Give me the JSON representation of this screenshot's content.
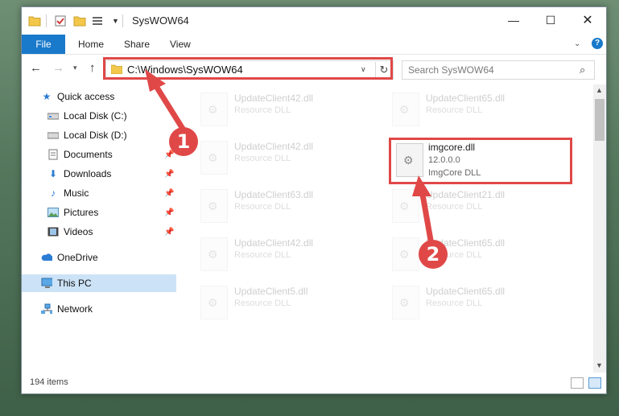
{
  "titlebar": {
    "title": "SysWOW64",
    "minimize": "—",
    "maximize": "☐",
    "close": "✕"
  },
  "ribbon": {
    "tabs": [
      "File",
      "Home",
      "Share",
      "View"
    ],
    "help": "?"
  },
  "navigation": {
    "address_path": "C:\\Windows\\SysWOW64",
    "search_placeholder": "Search SysWOW64"
  },
  "sidebar": {
    "items": [
      {
        "label": "Quick access",
        "icon": "star-icon"
      },
      {
        "label": "Local Disk (C:)",
        "icon": "drive-icon"
      },
      {
        "label": "Local Disk (D:)",
        "icon": "drive-icon"
      },
      {
        "label": "Documents",
        "icon": "documents-icon",
        "pinned": true
      },
      {
        "label": "Downloads",
        "icon": "downloads-icon",
        "pinned": true
      },
      {
        "label": "Music",
        "icon": "music-icon",
        "pinned": true
      },
      {
        "label": "Pictures",
        "icon": "pictures-icon",
        "pinned": true
      },
      {
        "label": "Videos",
        "icon": "videos-icon",
        "pinned": true
      },
      {
        "label": "OneDrive",
        "icon": "cloud-icon"
      },
      {
        "label": "This PC",
        "icon": "computer-icon",
        "selected": true
      },
      {
        "label": "Network",
        "icon": "network-icon"
      }
    ]
  },
  "files": [
    {
      "name": "UpdateClient42.dll",
      "desc": "Resource DLL"
    },
    {
      "name": "UpdateClient65.dll",
      "desc": "Resource DLL"
    },
    {
      "name": "UpdateClient42.dll",
      "desc": "Resource DLL"
    },
    {
      "name": "imgcore.dll",
      "version": "12.0.0.0",
      "desc": "ImgCore DLL"
    },
    {
      "name": "UpdateClient63.dll",
      "desc": "Resource DLL"
    },
    {
      "name": "UpdateClient21.dll",
      "desc": "Resource DLL"
    },
    {
      "name": "UpdateClient42.dll",
      "desc": "Resource DLL"
    },
    {
      "name": "UpdateClient65.dll",
      "desc": "Resource DLL"
    },
    {
      "name": "UpdateClient5.dll",
      "desc": "Resource DLL"
    },
    {
      "name": "UpdateClient65.dll",
      "desc": "Resource DLL"
    }
  ],
  "status": {
    "item_count": "194 items"
  },
  "annotations": {
    "step1": "1",
    "step2": "2",
    "highlight_color": "#e04848"
  }
}
